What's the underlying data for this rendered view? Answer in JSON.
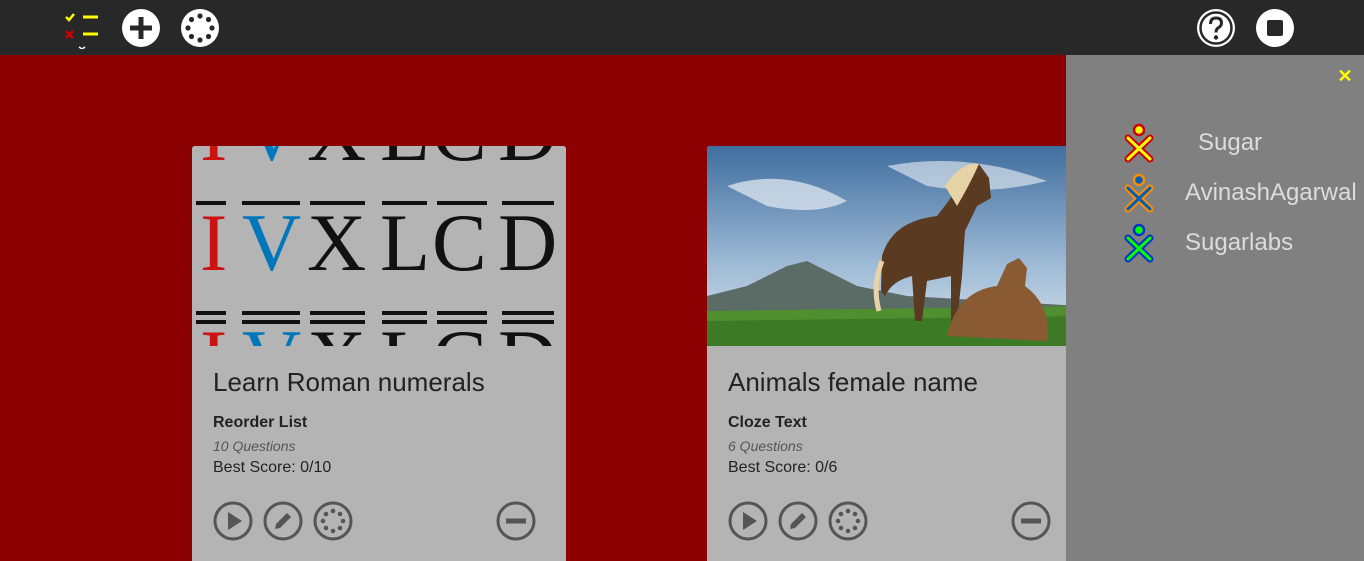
{
  "toolbar": {
    "icons": [
      "checklist-icon",
      "add-icon",
      "network-icon",
      "help-icon",
      "stop-icon"
    ],
    "colors": {
      "background": "#282828",
      "icon": "#ffffff",
      "check": "#ffff00",
      "cross": "#cc0000"
    }
  },
  "cards": [
    {
      "title": "Learn Roman numerals",
      "type": "Reorder List",
      "questions": "10 Questions",
      "score": "Best Score: 0/10",
      "image_glyphs": [
        "I",
        "V",
        "X",
        "L",
        "C",
        "D"
      ]
    },
    {
      "title": "Animals female name",
      "type": "Cloze Text",
      "questions": "6 Questions",
      "score": "Best Score: 0/6",
      "image": "horses-photo"
    }
  ],
  "panel": {
    "close_icon": "close-icon",
    "users": [
      {
        "name": "Sugar",
        "stroke": "#cc0000",
        "fill": "#ffff00"
      },
      {
        "name": "AvinashAgarwal",
        "stroke": "#ff8c00",
        "fill": "#005fb4"
      },
      {
        "name": "Sugarlabs",
        "stroke": "#0033cc",
        "fill": "#00ff00"
      }
    ]
  },
  "colors": {
    "main_bg": "#8b0000",
    "panel_bg": "#808080",
    "card_bg": "#b4b4b4"
  }
}
